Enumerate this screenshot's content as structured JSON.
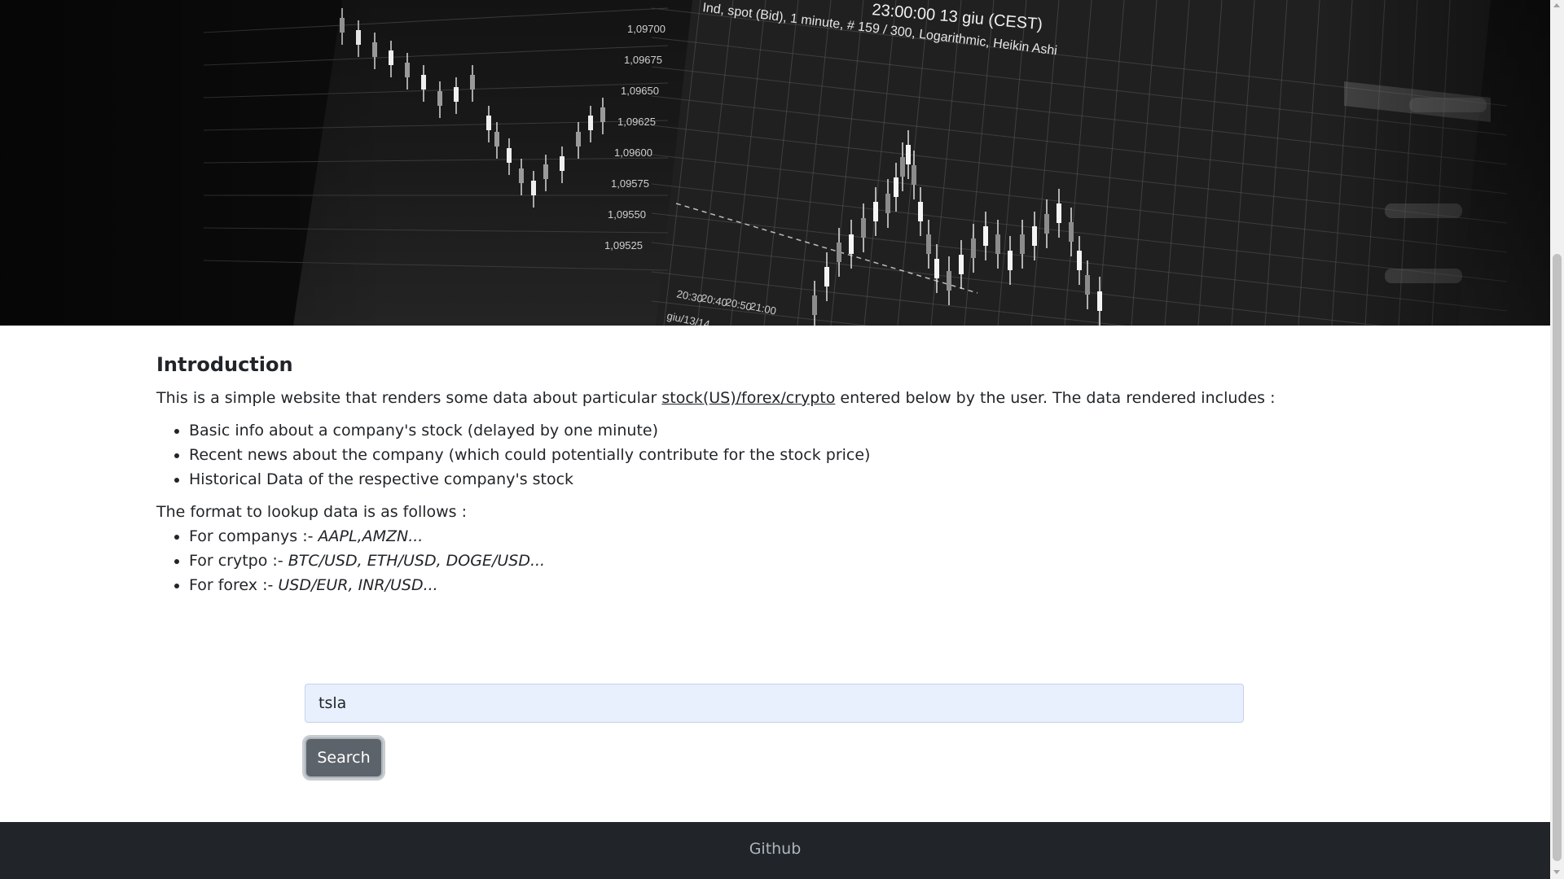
{
  "hero": {
    "chart_header": "Ind, spot (Bid), 1 minute, # 159 / 300, Logarithmic, Heikin Ashi",
    "chart_time": "23:00:00  13 giu (CEST)",
    "price_labels": [
      "1,09700",
      "1,09675",
      "1,09650",
      "1,09625",
      "1,09600",
      "1,09575",
      "1,09550",
      "1,09525"
    ],
    "time_labels": [
      "20:30",
      "20:40",
      "20:50",
      "21:00"
    ],
    "date_label": "giu/13/14"
  },
  "intro": {
    "title": "Introduction",
    "text_before": "This is a simple website that renders some data about particular ",
    "link_text": "stock(US)/forex/crypto",
    "text_after": " entered below by the user. The data rendered includes :",
    "features": [
      "Basic info about a company's stock (delayed by one minute)",
      "Recent news about the company (which could potentially contribute for the stock price)",
      "Historical Data of the respective company's stock"
    ],
    "format_heading": "The format to lookup data is as follows :",
    "formats": [
      {
        "label": "For companys :- ",
        "examples": "AAPL,AMZN..."
      },
      {
        "label": "For crytpo :- ",
        "examples": "BTC/USD, ETH/USD, DOGE/USD..."
      },
      {
        "label": "For forex :- ",
        "examples": "USD/EUR, INR/USD..."
      }
    ]
  },
  "search": {
    "value": "tsla",
    "button_label": "Search"
  },
  "footer": {
    "link_label": "Github"
  }
}
